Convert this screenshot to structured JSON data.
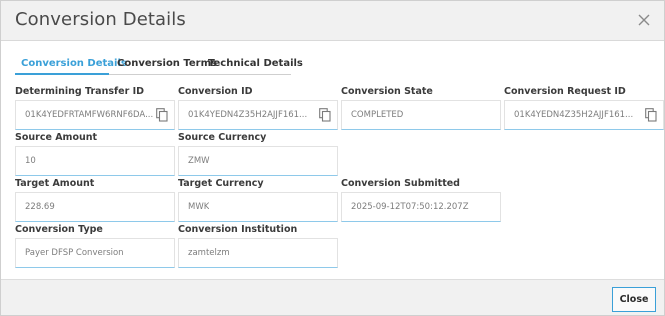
{
  "dialog": {
    "title": "Conversion Details",
    "close_button_label": "Close"
  },
  "tabs": [
    {
      "label": "Conversion Details",
      "active": true
    },
    {
      "label": "Conversion Terms",
      "active": false
    },
    {
      "label": "Technical Details",
      "active": false
    }
  ],
  "fields": {
    "determining_transfer_id": {
      "label": "Determining Transfer ID",
      "value": "01K4YEDFRTAMFW6RNF6DA...",
      "copyable": true
    },
    "conversion_id": {
      "label": "Conversion ID",
      "value": "01K4YEDN4Z35H2AJJF161...",
      "copyable": true
    },
    "conversion_state": {
      "label": "Conversion State",
      "value": "COMPLETED"
    },
    "conversion_request_id": {
      "label": "Conversion Request ID",
      "value": "01K4YEDN4Z35H2AJJF161...",
      "copyable": true
    },
    "source_amount": {
      "label": "Source Amount",
      "value": "10"
    },
    "source_currency": {
      "label": "Source Currency",
      "value": "ZMW"
    },
    "target_amount": {
      "label": "Target Amount",
      "value": "228.69"
    },
    "target_currency": {
      "label": "Target Currency",
      "value": "MWK"
    },
    "conversion_submitted": {
      "label": "Conversion Submitted",
      "value": "2025-09-12T07:50:12.207Z"
    },
    "conversion_type": {
      "label": "Conversion Type",
      "value": "Payer DFSP Conversion"
    },
    "conversion_institution": {
      "label": "Conversion Institution",
      "value": "zamtelzm"
    }
  },
  "icons": {
    "close": "close-icon",
    "copy": "copy-icon"
  },
  "colors": {
    "accent": "#3aa0d8",
    "header_bg": "#f1f1f1"
  }
}
